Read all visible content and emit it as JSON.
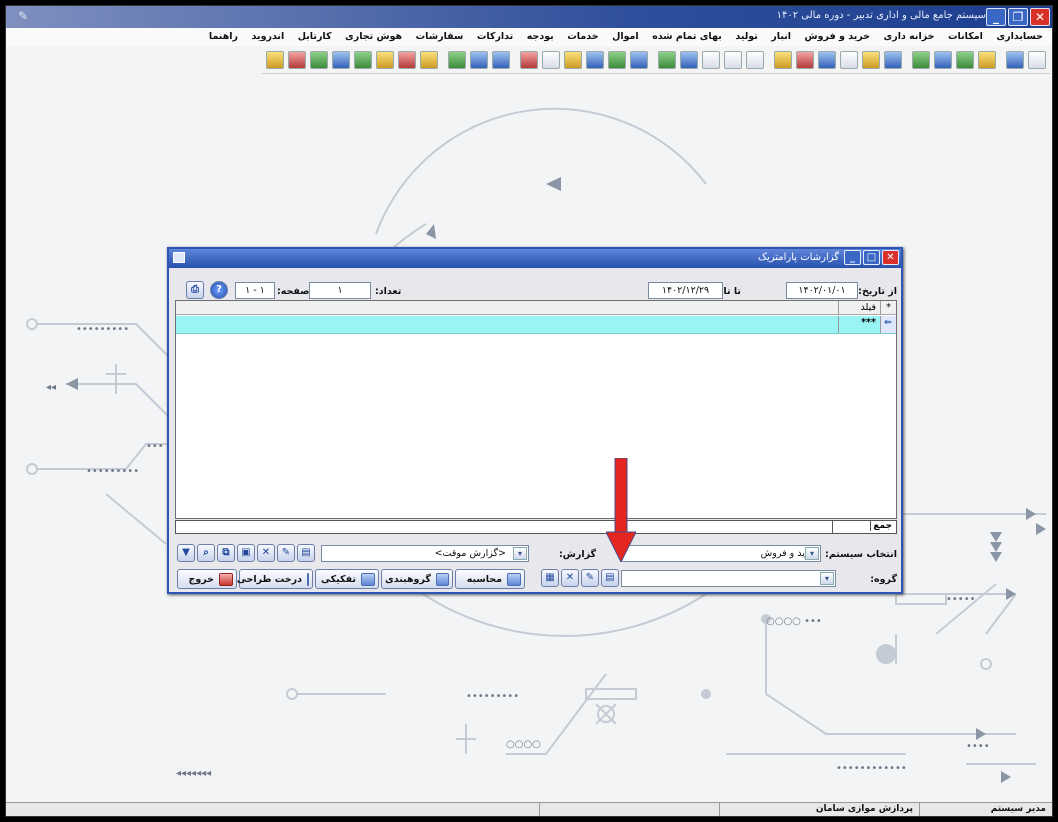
{
  "window": {
    "title": "سیستم جامع مالی و اداری تدبیر - دوره مالی ۱۴۰۲"
  },
  "menu": [
    "حسابداری",
    "امکانات",
    "خزانه داری",
    "خرید و فروش",
    "انبار",
    "تولید",
    "بهای تمام شده",
    "اموال",
    "خدمات",
    "بودجه",
    "تدارکات",
    "سفارشات",
    "هوش تجاری",
    "کارتابل",
    "اندروید",
    "راهنما"
  ],
  "dialog": {
    "title": "گزارشات پارامتریک",
    "from_date_label": "از تاریخ:",
    "from_date": "۱۴۰۲/۰۱/۰۱",
    "to_date_label": "تا تاریخ:",
    "to_date": "۱۴۰۲/۱۲/۲۹",
    "count_label": "تعداد:",
    "count_value": "۱",
    "page_label": "صفحه:",
    "page_value": "۱ - ۱",
    "grid": {
      "col_marker": "*",
      "col_field": "فیلد",
      "row_value": "***"
    },
    "sum_label": "جمع",
    "system_label": "انتخاب سیستم:",
    "system_value": "خرید و فروش",
    "report_label": "گزارش:",
    "report_value": "<گزارش موقت>",
    "group_label": "گروه:",
    "group_value": "",
    "buttons": {
      "calc": "محاسبه",
      "grouping": "گروهبندی",
      "separate": "تفکیکی",
      "tree_design": "درخت طراحی",
      "exit": "خروج"
    }
  },
  "statusbar": {
    "user": "مدیر سیستم",
    "company": "پردازش موازی سامان"
  },
  "colors": {
    "accent": "#2750ad",
    "grid_selected": "#9af4f4",
    "arrow": "#e3261f"
  }
}
